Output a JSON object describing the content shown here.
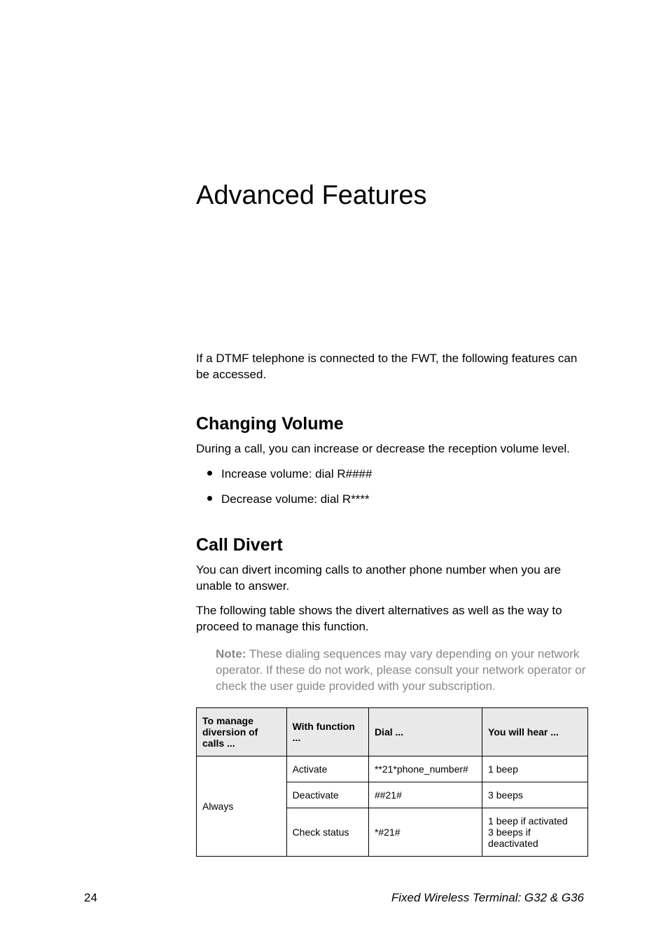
{
  "title": "Advanced Features",
  "intro": "If a DTMF telephone is connected to the FWT, the following features can be accessed.",
  "sections": {
    "volume": {
      "heading": "Changing Volume",
      "para": "During a call, you can increase or decrease the reception volume level.",
      "bullets": [
        "Increase volume: dial R####",
        "Decrease volume: dial R****"
      ]
    },
    "divert": {
      "heading": "Call Divert",
      "para1": "You can divert incoming calls to another phone number when you are unable to answer.",
      "para2": "The following table shows the divert alternatives as well as the way to proceed to manage this function.",
      "note_label": "Note:",
      "note_text": " These dialing sequences may vary depending on your network operator. If these do not work, please consult your network operator or check the user guide provided with your subscription.",
      "table": {
        "headers": [
          "To manage diversion of calls ...",
          "With function ...",
          "Dial ...",
          "You will hear ..."
        ],
        "group_label": "Always",
        "rows": [
          {
            "func": "Activate",
            "dial": "**21*phone_number#",
            "hear": "1 beep"
          },
          {
            "func": "Deactivate",
            "dial": "##21#",
            "hear": "3 beeps"
          },
          {
            "func": "Check status",
            "dial": "*#21#",
            "hear": "1 beep if activated\n3 beeps if deactivated"
          }
        ]
      }
    }
  },
  "footer": {
    "page_number": "24",
    "book_title": "Fixed Wireless Terminal: G32 & G36"
  }
}
